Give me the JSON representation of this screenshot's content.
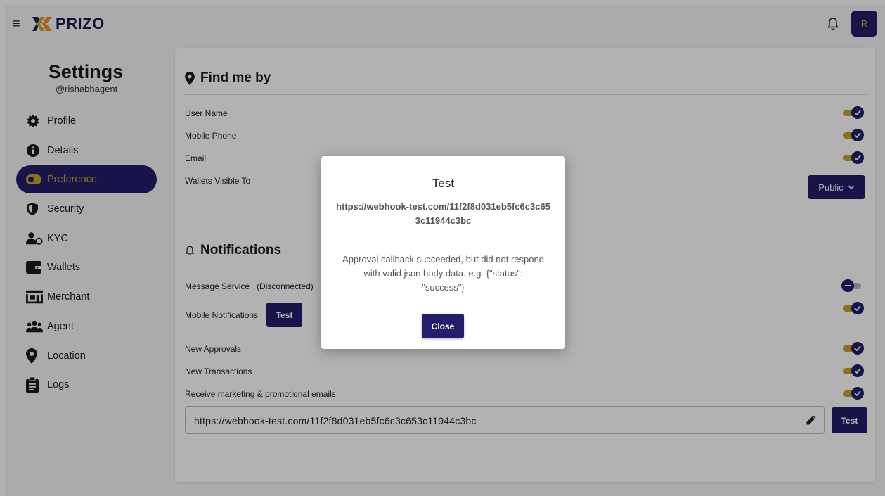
{
  "app": {
    "brand": "PRIZO",
    "avatar_initial": "R"
  },
  "sidebar": {
    "title": "Settings",
    "username": "@rishabhagent",
    "items": [
      {
        "label": "Profile",
        "icon": "gear-icon"
      },
      {
        "label": "Details",
        "icon": "info-icon"
      },
      {
        "label": "Preference",
        "icon": "toggle-icon",
        "active": true
      },
      {
        "label": "Security",
        "icon": "shield-icon"
      },
      {
        "label": "KYC",
        "icon": "user-check-icon"
      },
      {
        "label": "Wallets",
        "icon": "wallet-icon"
      },
      {
        "label": "Merchant",
        "icon": "store-icon"
      },
      {
        "label": "Agent",
        "icon": "users-icon"
      },
      {
        "label": "Location",
        "icon": "map-pin-icon"
      },
      {
        "label": "Logs",
        "icon": "clipboard-icon"
      }
    ]
  },
  "find_me": {
    "title": "Find me by",
    "rows": [
      {
        "label": "User Name",
        "on": true
      },
      {
        "label": "Mobile Phone",
        "on": true
      },
      {
        "label": "Email",
        "on": true
      }
    ],
    "wallets_label": "Wallets Visible To",
    "wallets_value": "Public"
  },
  "notifications": {
    "title": "Notifications",
    "message_service": "Message Service",
    "message_status": "(Disconnected)",
    "mobile_label": "Mobile Notifications",
    "test_label": "Test",
    "rows": [
      {
        "label": "New Approvals",
        "on": true
      },
      {
        "label": "New Transactions",
        "on": true
      },
      {
        "label": "Receive marketing & promotional emails",
        "on": true
      }
    ],
    "webhook_value": "https://webhook-test.com/11f2f8d031eb5fc6c3c653c11944c3bc",
    "webhook_test_label": "Test"
  },
  "modal": {
    "title": "Test",
    "url": "https://webhook-test.com/11f2f8d031eb5fc6c3c653c11944c3bc",
    "message": "Approval callback succeeded, but did not respond with valid json body data. e.g. {\"status\": \"success\"}",
    "close_label": "Close"
  },
  "colors": {
    "primary": "#231d6b",
    "accent": "#c9a227"
  }
}
